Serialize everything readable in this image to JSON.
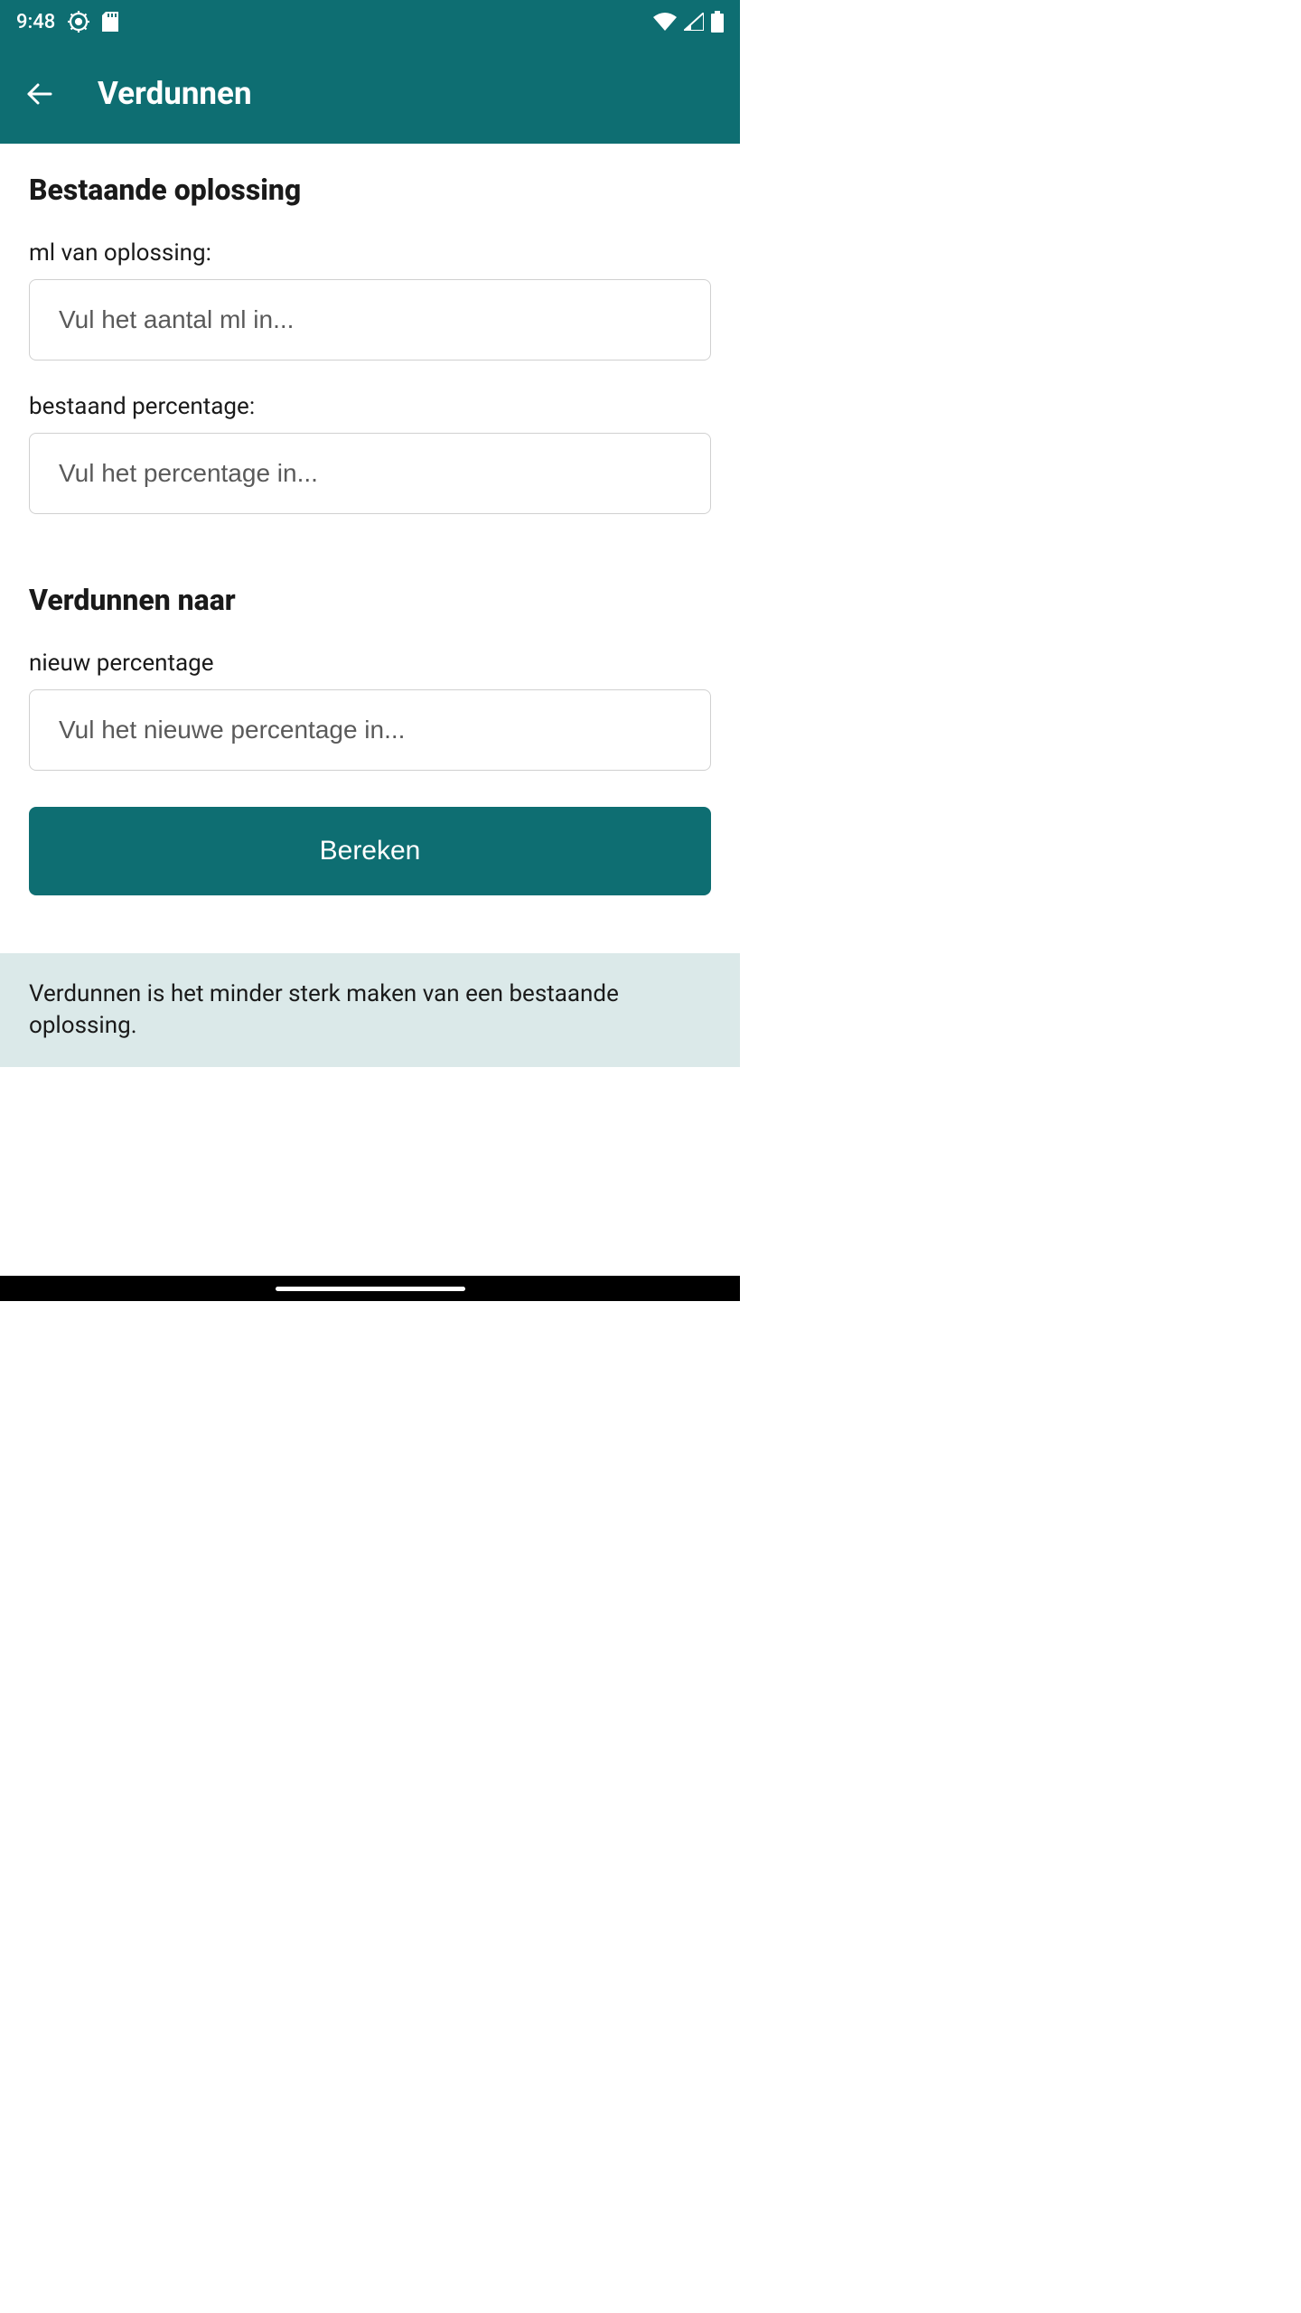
{
  "status": {
    "time": "9:48"
  },
  "appbar": {
    "title": "Verdunnen"
  },
  "section_existing": {
    "title": "Bestaande oplossing",
    "ml_label": "ml van oplossing:",
    "ml_placeholder": "Vul het aantal ml in...",
    "percent_label": "bestaand percentage:",
    "percent_placeholder": "Vul het percentage in..."
  },
  "section_dilute": {
    "title": "Verdunnen naar",
    "new_percent_label": "nieuw percentage",
    "new_percent_placeholder": "Vul het nieuwe percentage in..."
  },
  "actions": {
    "calculate": "Bereken"
  },
  "info": {
    "text": "Verdunnen is het minder sterk maken van een bestaande oplossing."
  }
}
